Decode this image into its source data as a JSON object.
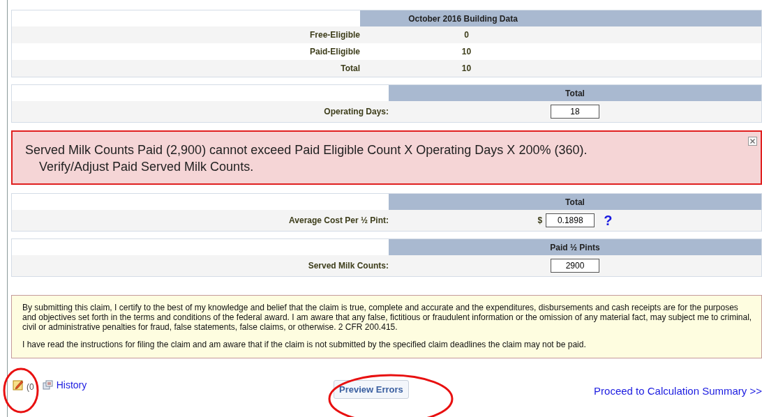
{
  "building_data": {
    "header": "October 2016 Building Data",
    "rows": [
      {
        "label": "Free-Eligible",
        "value": "0"
      },
      {
        "label": "Paid-Eligible",
        "value": "10"
      },
      {
        "label": "Total",
        "value": "10"
      }
    ]
  },
  "operating": {
    "header": "Total",
    "label": "Operating Days:",
    "value": "18"
  },
  "error": {
    "lines": [
      "Served Milk Counts Paid (2,900) cannot exceed Paid Eligible Count X Operating Days X 200% (360).",
      "Verify/Adjust Paid Served Milk Counts."
    ]
  },
  "cost": {
    "header": "Total",
    "label": "Average Cost Per ½ Pint:",
    "prefix": "$",
    "value": "0.1898",
    "help": "?"
  },
  "milk": {
    "header": "Paid ½ Pints",
    "label": "Served Milk Counts:",
    "value": "2900"
  },
  "certification": [
    "By submitting this claim, I certify to the best of my knowledge and belief that the claim is true, complete and accurate and the expenditures, disbursements and cash receipts are for the purposes and objectives set forth in the terms and conditions of the federal award. I am aware that any false, fictitious or fraudulent information or the omission of any material fact, may subject me to criminal, civil or administrative penalties for fraud, false statements, false claims, or otherwise. 2 CFR 200.415.",
    "I have read the instructions for filing the claim and am aware that if the claim is not submitted by the specified claim deadlines the claim may not be paid."
  ],
  "footer": {
    "notes_count": "(0",
    "history": "History",
    "preview_button": "Preview Errors",
    "proceed_link": "Proceed to Calculation Summary >>"
  }
}
